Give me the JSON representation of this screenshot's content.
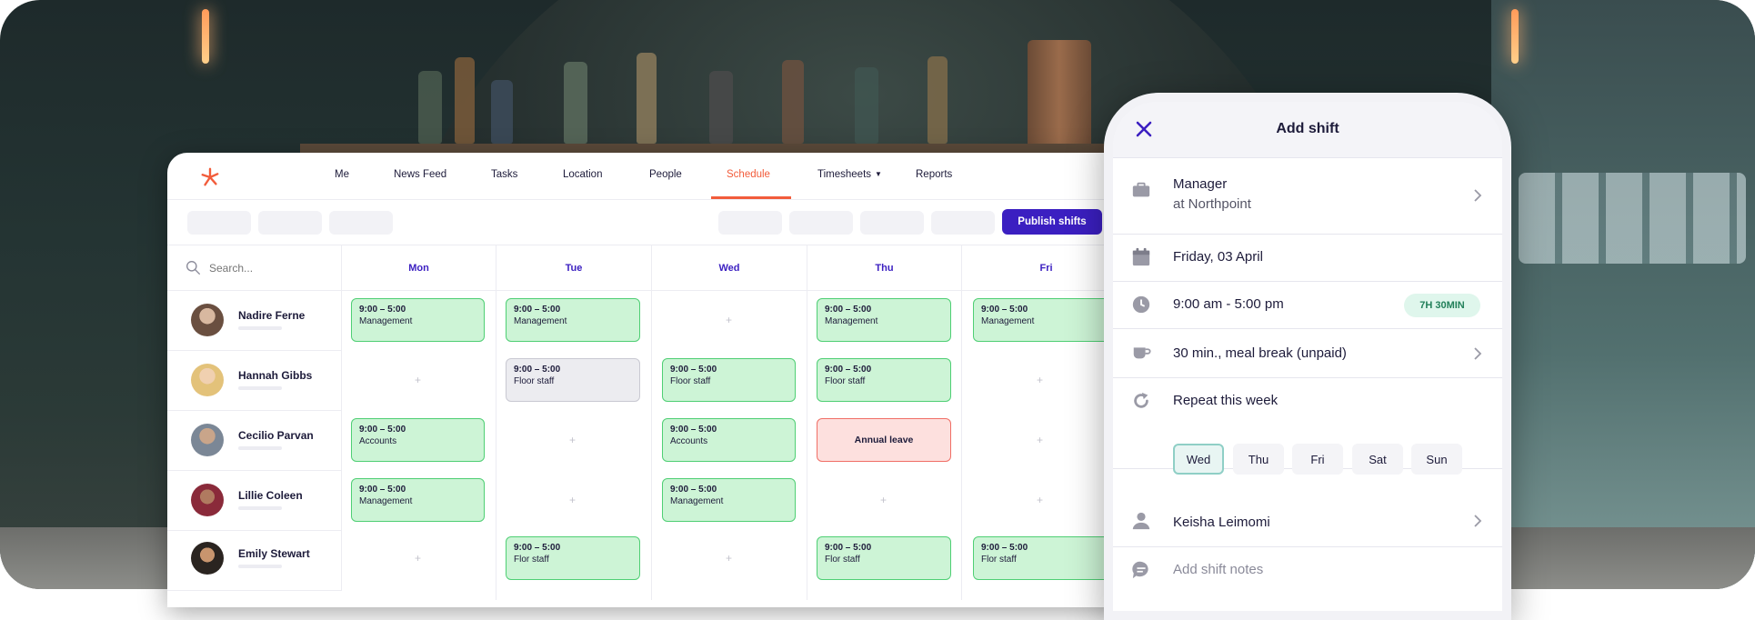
{
  "nav": {
    "items": [
      "Me",
      "News Feed",
      "Tasks",
      "Location",
      "People",
      "Schedule",
      "Timesheets",
      "Reports"
    ],
    "active": "Schedule"
  },
  "toolbar": {
    "publish_label": "Publish shifts"
  },
  "search": {
    "placeholder": "Search..."
  },
  "days": [
    "Mon",
    "Tue",
    "Wed",
    "Thu",
    "Fri"
  ],
  "people": [
    {
      "name": "Nadire Ferne"
    },
    {
      "name": "Hannah Gibbs"
    },
    {
      "name": "Cecilio Parvan"
    },
    {
      "name": "Lillie Coleen"
    },
    {
      "name": "Emily Stewart"
    }
  ],
  "shifts": {
    "time": "9:00 – 5:00",
    "management": "Management",
    "floor_staff": "Floor staff",
    "accounts": "Accounts",
    "flor_staff": "Flor staff",
    "annual_leave": "Annual leave"
  },
  "empty_cell_symbol": "+",
  "colors": {
    "accent": "#3b1fc1",
    "nav_active": "#f25c3b",
    "shift_green": "#cdf4d6",
    "leave_red": "#fde0de"
  },
  "panel": {
    "title": "Add shift",
    "role": "Manager",
    "location": "at Northpoint",
    "date": "Friday, 03 April",
    "time_range": "9:00 am - 5:00 pm",
    "duration": "7H 30MIN",
    "meal_break": "30 min., meal break (unpaid)",
    "repeat_label": "Repeat this week",
    "repeat_days": [
      "Wed",
      "Thu",
      "Fri",
      "Sat",
      "Sun"
    ],
    "repeat_selected": "Wed",
    "employee": "Keisha Leimomi",
    "notes_placeholder": "Add shift notes"
  },
  "icons": [
    "logo-icon",
    "search-icon",
    "close-icon",
    "briefcase-icon",
    "calendar-icon",
    "clock-icon",
    "cup-icon",
    "repeat-icon",
    "person-icon",
    "comment-icon",
    "chevron-right-icon"
  ]
}
